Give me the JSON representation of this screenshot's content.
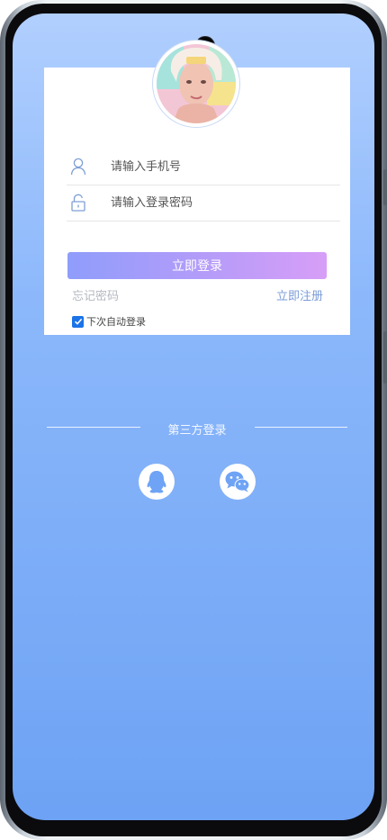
{
  "login": {
    "phone_placeholder": "请输入手机号",
    "password_placeholder": "请输入登录密码",
    "submit_label": "立即登录",
    "forgot_label": "忘记密码",
    "register_label": "立即注册",
    "remember_label": "下次自动登录",
    "remember_checked": true
  },
  "third_party": {
    "title": "第三方登录",
    "providers": [
      "qq-icon",
      "wechat-icon"
    ]
  },
  "colors": {
    "accent": "#1b73e8",
    "link": "#7b9cd8",
    "button_start": "#8f9dfb",
    "button_end": "#d79ef7",
    "background_top": "#b1cffe",
    "background_bottom": "#6da2f4"
  }
}
